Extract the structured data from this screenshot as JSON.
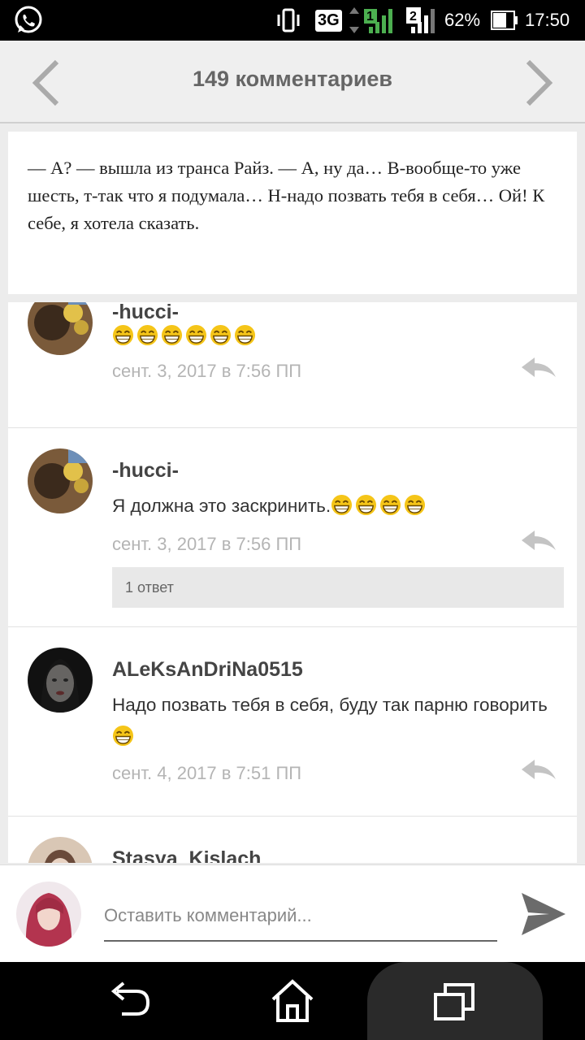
{
  "status_bar": {
    "network": "3G",
    "sim1": "1",
    "sim2": "2",
    "battery": "62%",
    "time": "17:50",
    "icons": [
      "whatsapp-icon",
      "vibrate-icon",
      "signal-icon",
      "battery-icon"
    ]
  },
  "header": {
    "title": "149 комментариев",
    "prev_icon": "chevron-left-icon",
    "next_icon": "chevron-right-icon"
  },
  "story": {
    "text": "— А? — вышла из транса Райз. — А, ну да… В-вообще-то уже шесть, т-так что я подумала… Н-надо позвать тебя в себя… Ой! К себе, я хотела сказать."
  },
  "comments": [
    {
      "author": "-hucci-",
      "text": "",
      "emoji_count": 6,
      "date": "сент. 3, 2017 в 7:56 ПП"
    },
    {
      "author": "-hucci-",
      "text": "Я должна это заскринить.",
      "emoji_count": 4,
      "date": "сент. 3, 2017 в 7:56 ПП",
      "replies_label": "1 ответ"
    },
    {
      "author": "ALeKsAnDriNa0515",
      "text": "Надо позвать тебя в себя, буду так парню говорить",
      "emoji_count": 1,
      "date": "сент. 4, 2017 в 7:51 ПП"
    },
    {
      "author": "Stasya_Kislach",
      "text": "",
      "emoji_count": 0,
      "date": ""
    }
  ],
  "composer": {
    "placeholder": "Оставить комментарий...",
    "send_icon": "send-icon"
  },
  "navbar": {
    "icons": [
      "back-icon",
      "home-icon",
      "recents-icon"
    ]
  },
  "colors": {
    "header_bg": "#efefef",
    "title": "#666666",
    "date": "#b4b4b4",
    "emoji": "#f5c518"
  }
}
